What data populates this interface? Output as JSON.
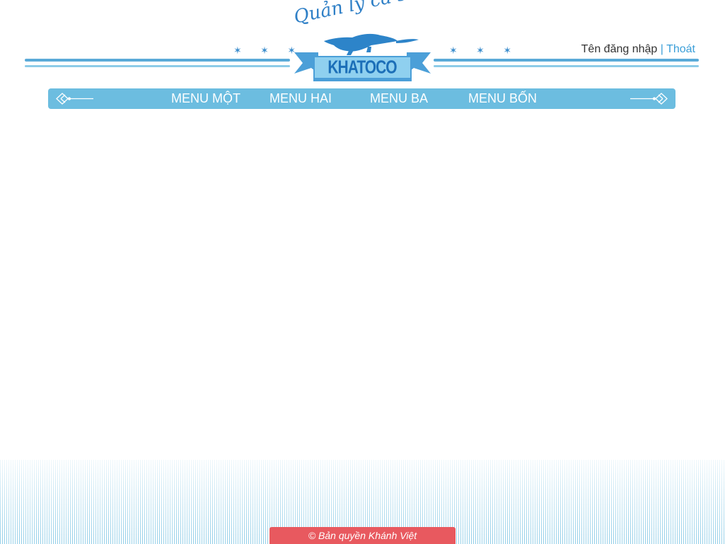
{
  "header": {
    "logo_script": "Quản lý cá sấu",
    "brand": "KHATOCO",
    "stars_left": "✶ ✶ ✶",
    "stars_right": "✶ ✶ ✶"
  },
  "auth": {
    "username_label": "Tên đăng nhập",
    "separator": "|",
    "logout_label": "Thoát"
  },
  "nav": {
    "items": [
      {
        "label": "MENU MỘT"
      },
      {
        "label": "MENU HAI"
      },
      {
        "label": "MENU BA"
      },
      {
        "label": "MENU BỐN"
      }
    ]
  },
  "footer": {
    "copyright": "© Bản quyền Khánh Việt"
  },
  "colors": {
    "accent": "#6cbde0",
    "brand": "#2e7fc6",
    "footer_badge": "#e8595f"
  }
}
